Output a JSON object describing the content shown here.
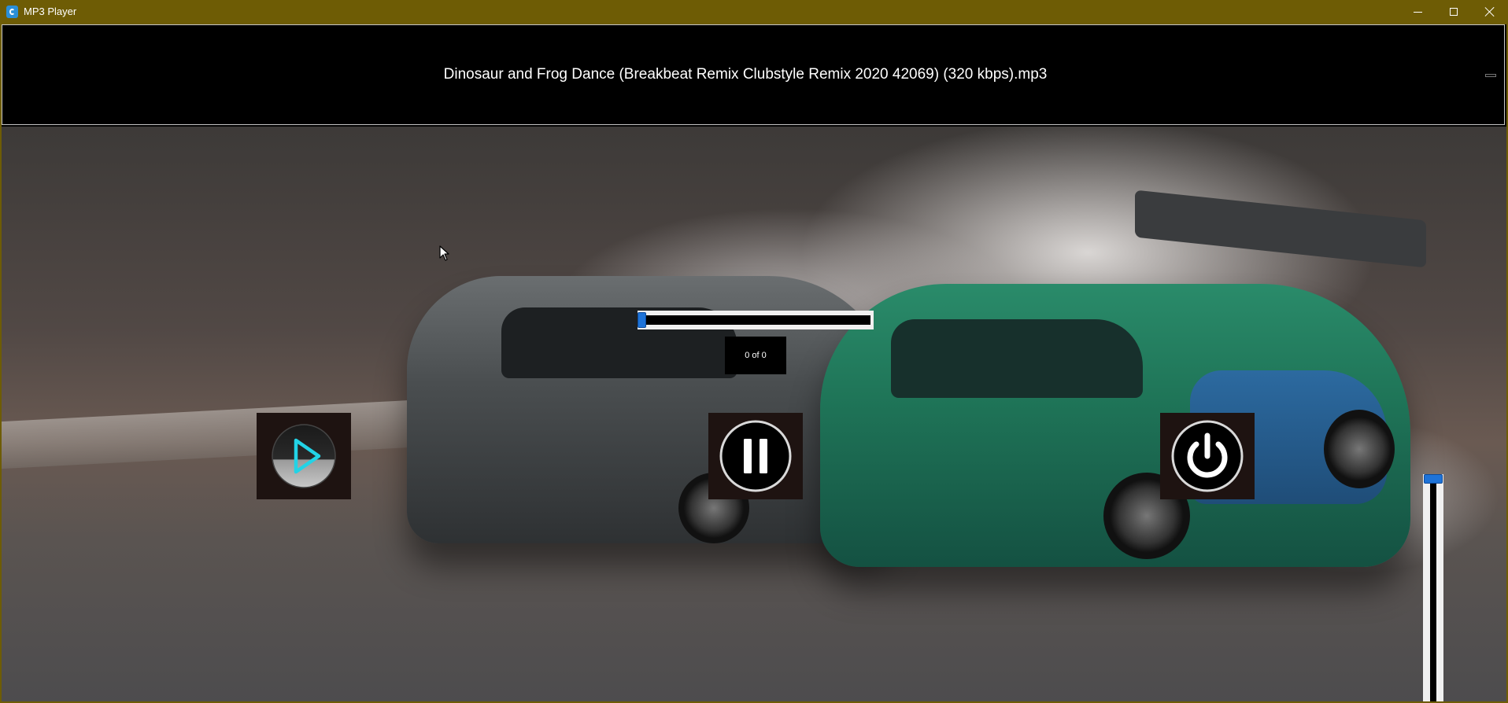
{
  "window": {
    "title": "MP3 Player",
    "buttons": {
      "minimize": "minimize-icon",
      "maximize": "maximize-icon",
      "close": "close-icon"
    }
  },
  "now_playing": {
    "title": "Dinosaur and Frog Dance (Breakbeat Remix Clubstyle Remix 2020 42069) (320 kbps).mp3"
  },
  "playback": {
    "track_counter": "0 of 0",
    "seek_position": 0.0,
    "volume_level": 1.0
  },
  "controls": {
    "play_icon": "play-icon",
    "pause_icon": "pause-icon",
    "power_icon": "power-icon"
  },
  "background": {
    "description_icon": "background-image"
  },
  "colors": {
    "titlebar": "#6e5c05",
    "slider_thumb": "#1e73d8",
    "play_accent": "#22d3e6",
    "button_bg": "#1e1311"
  }
}
